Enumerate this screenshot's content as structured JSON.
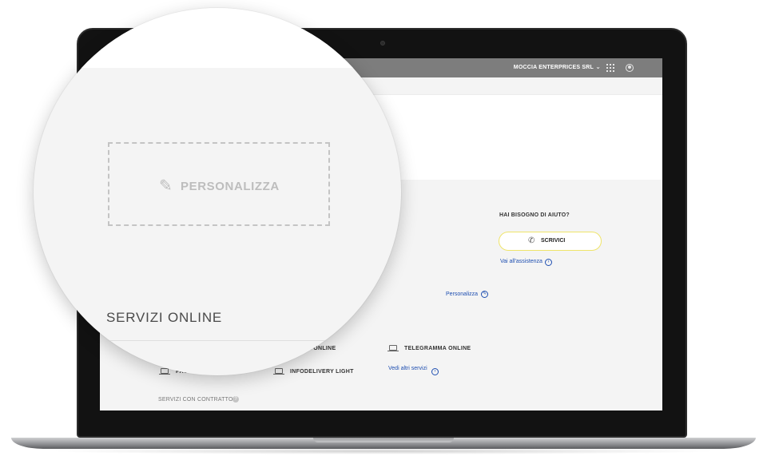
{
  "header": {
    "company": "MOCCIA ENTERPRICES SRL",
    "company_dropdown_icon": "chevron-down-icon",
    "apps_icon": "grid-icon",
    "account_icon": "user-icon"
  },
  "help": {
    "title": "HAI BISOGNO DI AIUTO?",
    "contact_button": "SCRIVICI",
    "support_link": "Vai all'assistenza"
  },
  "customize": {
    "link": "Personalizza",
    "box_label": "PERSONALIZZA"
  },
  "services": {
    "title": "SERVIZI ONLINE",
    "items": [
      {
        "label": "TERA ONLINE"
      },
      {
        "label": "TELEGRAMMA ONLINE"
      },
      {
        "label": "PACCOWEB"
      },
      {
        "label": "INFODELIVERY LIGHT"
      }
    ],
    "more_link": "Vedi altri servizi",
    "contract_label": "SERVIZI CON CONTRATTO",
    "contract_help": "?"
  },
  "colors": {
    "topbar": "#7d7d7d",
    "link": "#1f4fb1",
    "button_border": "#efe46a",
    "page_bg": "#f4f4f4"
  }
}
